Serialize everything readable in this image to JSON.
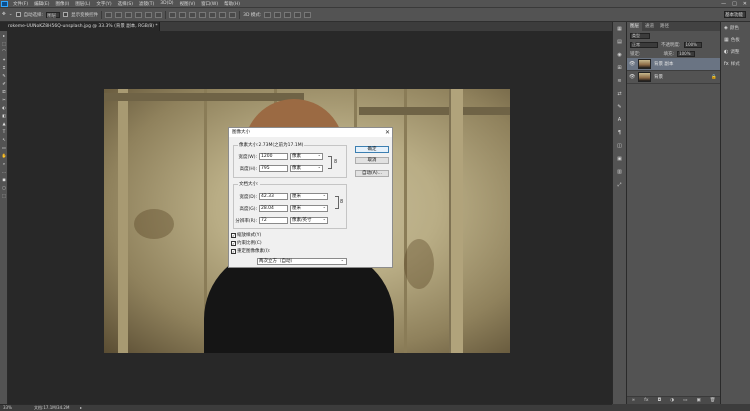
{
  "menu": {
    "logo": "Ps",
    "items": [
      "文件(F)",
      "编辑(E)",
      "图像(I)",
      "图层(L)",
      "文字(Y)",
      "选择(S)",
      "滤镜(T)",
      "3D(D)",
      "视图(V)",
      "窗口(W)",
      "帮助(H)"
    ],
    "window_controls": [
      "—",
      "□",
      "✕"
    ]
  },
  "options": {
    "move_icon": "✥",
    "auto_select_label": "自动选择:",
    "auto_select_value": "图层",
    "transform_label": "显示变换控件",
    "mode_label": "3D 模式:",
    "workspace_value": "基本功能"
  },
  "document": {
    "tab_title": "rokeme-UUNoKZ8H56Q-unsplash.jpg @ 33.3% (背景 副本, RGB/8) *",
    "close_icon": "×"
  },
  "tools": [
    "▸",
    "⬚",
    "⌒",
    "✦",
    "⌗",
    "✎",
    "✐",
    "⎚",
    "✂",
    "◐",
    "◧",
    "▲",
    "T",
    "↖",
    "▭",
    "✋",
    "⌕",
    "…",
    "◼",
    "◻",
    "⬚"
  ],
  "dialog": {
    "title": "图像大小",
    "close": "✕",
    "pixel_dims_legend": "像素大小:2.73M(之前为17.1M)",
    "width_label": "宽度(W):",
    "width_value": "1200",
    "width_unit": "像素",
    "height_label": "高度(H):",
    "height_value": "795",
    "height_unit": "像素",
    "doc_size_legend": "文档大小:",
    "doc_width_label": "宽度(D):",
    "doc_width_value": "42.33",
    "doc_width_unit": "厘米",
    "doc_height_label": "高度(G):",
    "doc_height_value": "28.04",
    "doc_height_unit": "厘米",
    "resolution_label": "分辨率(R):",
    "resolution_value": "72",
    "resolution_unit": "像素/英寸",
    "ok_label": "确定",
    "cancel_label": "取消",
    "auto_label": "自动(A)...",
    "scale_styles_label": "缩放样式(Y)",
    "constrain_label": "约束比例(C)",
    "resample_label": "重定图像像素(I):",
    "resample_method": "两次立方（自动）",
    "chain_icon": "8",
    "check_mark": "✓"
  },
  "layers_panel": {
    "tabs": [
      "图层",
      "通道",
      "路径"
    ],
    "kind_label": "类型",
    "blend_mode": "正常",
    "opacity_label": "不透明度:",
    "opacity_value": "100%",
    "lock_label": "锁定:",
    "fill_label": "填充:",
    "fill_value": "100%",
    "layers": [
      {
        "name": "背景 副本",
        "eye": "👁",
        "lock": ""
      },
      {
        "name": "背景",
        "eye": "👁",
        "lock": "🔒"
      }
    ],
    "bottom_icons": [
      "∞",
      "fx",
      "◘",
      "◑",
      "▭",
      "▣",
      "🗑"
    ]
  },
  "panel_icons": [
    "▦",
    "▤",
    "◉",
    "⊞",
    "≋",
    "⇄",
    "✎",
    "A",
    "¶",
    "◫",
    "▣",
    "▥",
    "⤢"
  ],
  "right_strip": [
    {
      "icon": "◈",
      "label": "颜色"
    },
    {
      "icon": "▦",
      "label": "色板"
    },
    {
      "icon": "◐",
      "label": "调整"
    },
    {
      "icon": "fx",
      "label": "样式"
    }
  ],
  "status": {
    "zoom": "33%",
    "doc_info": "文档:17.1M/34.2M",
    "arrow": "▸"
  }
}
